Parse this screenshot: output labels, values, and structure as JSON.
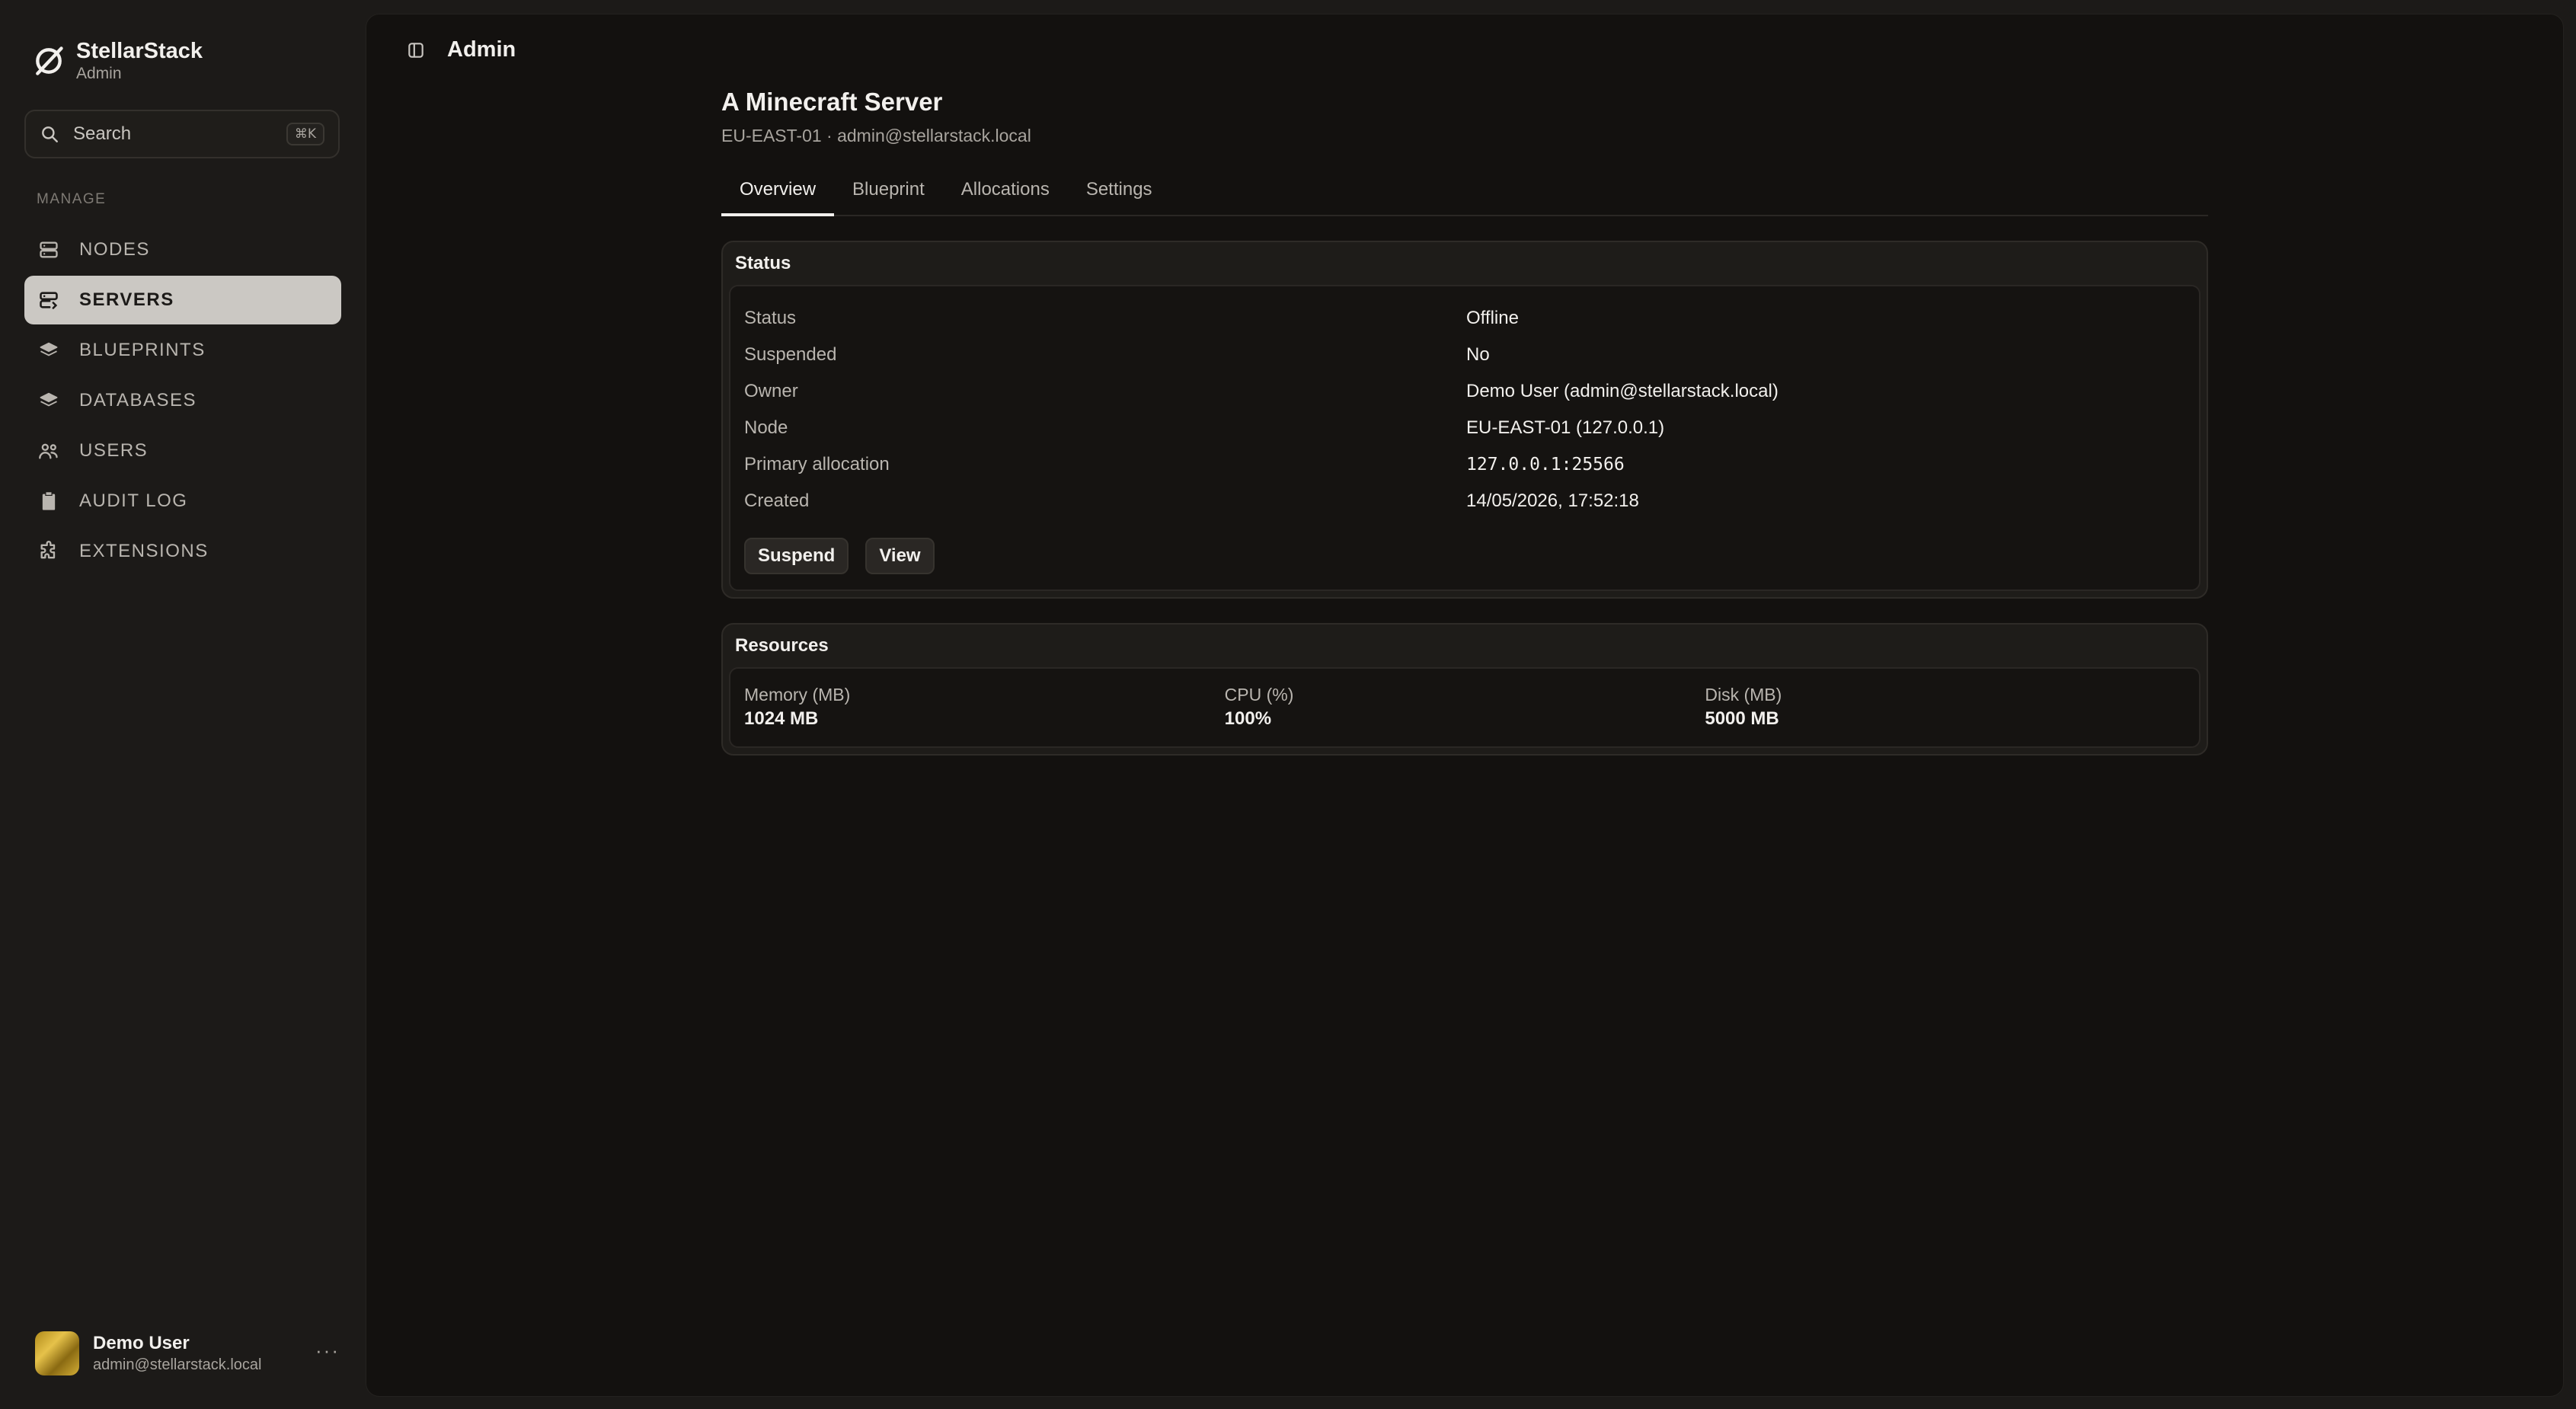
{
  "sidebar": {
    "brand": {
      "name": "StellarStack",
      "subtitle": "Admin"
    },
    "search": {
      "label": "Search",
      "shortcut": "⌘K"
    },
    "section_label": "MANAGE",
    "items": [
      {
        "label": "NODES",
        "icon": "server-icon",
        "active": false
      },
      {
        "label": "SERVERS",
        "icon": "server-edit-icon",
        "active": true
      },
      {
        "label": "BLUEPRINTS",
        "icon": "layers-icon",
        "active": false
      },
      {
        "label": "DATABASES",
        "icon": "layers-icon",
        "active": false
      },
      {
        "label": "USERS",
        "icon": "users-icon",
        "active": false
      },
      {
        "label": "AUDIT LOG",
        "icon": "clipboard-icon",
        "active": false
      },
      {
        "label": "EXTENSIONS",
        "icon": "puzzle-icon",
        "active": false
      }
    ],
    "user": {
      "name": "Demo User",
      "email": "admin@stellarstack.local",
      "more": "···"
    }
  },
  "header": {
    "title": "Admin"
  },
  "server": {
    "title": "A Minecraft Server",
    "subtitle": "EU-EAST-01 · admin@stellarstack.local"
  },
  "tabs": [
    {
      "label": "Overview",
      "active": true
    },
    {
      "label": "Blueprint",
      "active": false
    },
    {
      "label": "Allocations",
      "active": false
    },
    {
      "label": "Settings",
      "active": false
    }
  ],
  "status_card": {
    "title": "Status",
    "rows": [
      {
        "key": "Status",
        "value": "Offline"
      },
      {
        "key": "Suspended",
        "value": "No"
      },
      {
        "key": "Owner",
        "value": "Demo User (admin@stellarstack.local)"
      },
      {
        "key": "Node",
        "value": "EU-EAST-01 (127.0.0.1)"
      },
      {
        "key": "Primary allocation",
        "value": "127.0.0.1:25566"
      },
      {
        "key": "Created",
        "value": "14/05/2026, 17:52:18"
      }
    ],
    "buttons": {
      "suspend": "Suspend",
      "view": "View"
    }
  },
  "resources_card": {
    "title": "Resources",
    "items": [
      {
        "label": "Memory (MB)",
        "value": "1024 MB"
      },
      {
        "label": "CPU (%)",
        "value": "100%"
      },
      {
        "label": "Disk (MB)",
        "value": "5000 MB"
      }
    ]
  }
}
